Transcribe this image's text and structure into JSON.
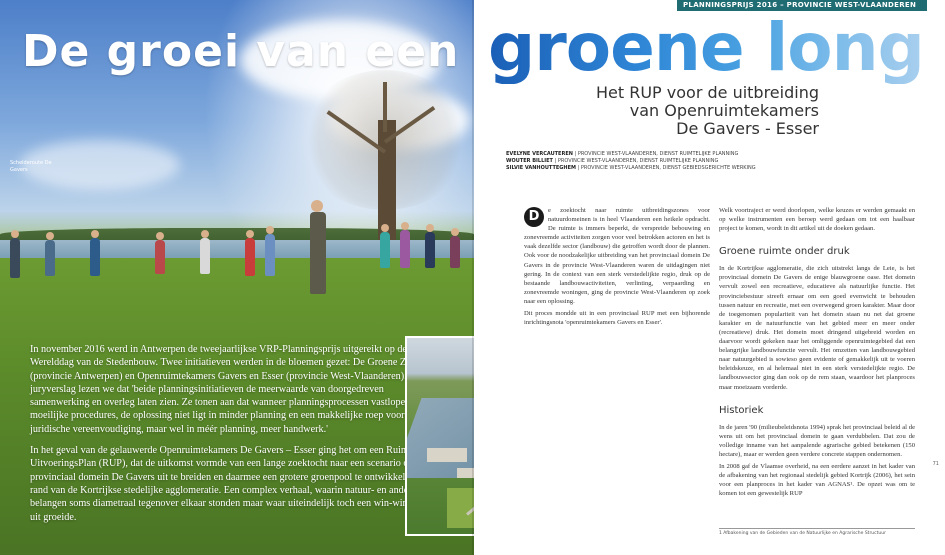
{
  "left_page": {
    "title": "De groei van een",
    "photo_credit": [
      "Schelderoute De",
      "Gavers"
    ],
    "intro_paragraphs": [
      "In november 2016 werd in Antwerpen de tweejaarlijkse VRP-Planningsprijs uitgereikt op de Werelddag van de Stedenbouw. Twee initiatieven werden in de bloemen gezet: De Groene Zes (provincie Antwerpen) en Openruimtekamers Gavers en Esser (provincie West-Vlaanderen). In het juryverslag lezen we dat 'beide planningsinitiatieven de meerwaarde van doorgedreven samenwerking en overleg laten zien. Ze tonen aan dat wanneer planningsprocessen vastlopen in moeilijke procedures, de oplossing niet ligt in minder planning en een makkelijke roep voor juridische vereenvoudiging, maar wel in méér planning, meer handwerk.'",
      "In het geval van de gelauwerde Openruimtekamers De Gavers – Esser ging het om een Ruimtelijk UitvoeringsPlan (RUP), dat de uitkomst vormde van een lange zoektocht naar een scenario om het provinciaal domein De Gavers uit te breiden en daarmee een grotere groenpool te ontwikkelen in de rand van de Kortrijkse stedelijke agglomeratie. Een complex verhaal, waarin natuur- en andere belangen soms diametraal tegenover elkaar stonden maar waar uiteindelijk toch een win-win situatie uit groeide."
    ]
  },
  "right_page": {
    "header_label": "PLANNINGSPRIJS 2016 – PROVINCIE WEST-VLAANDEREN",
    "title": "groene long",
    "subtitle_lines": [
      "Het RUP voor de uitbreiding",
      "van Openruimtekamers",
      "De Gavers - Esser"
    ],
    "authors": [
      {
        "name": "EVELYNE VERCAUTEREN",
        "affiliation": "PROVINCIE WEST-VLAANDEREN, DIENST RUIMTELIJKE PLANNING"
      },
      {
        "name": "WOUTER BILLIET",
        "affiliation": "PROVINCIE WEST-VLAANDEREN, DIENST RUIMTELIJKE PLANNING"
      },
      {
        "name": "SILVIE VANHOUTTEGHEM",
        "affiliation": "PROVINCIE WEST-VLAANDEREN, DIENST GEBIEDSGERICHTE WERKING"
      }
    ],
    "dropcap": "D",
    "col1_paragraphs": [
      "e zoektocht naar ruimte uitbreidingszones voor natuurdomeinen is in heel Vlaanderen een heikele opdracht. De ruimte is immers beperkt, de verspreide bebouwing en zonevreemde activiteiten zorgen voor veel betrokken actoren en het is vaak dezelfde sector (landbouw) die getroffen wordt door de plannen. Ook voor de noodzakelijke uitbreiding van het provinciaal domein De Gavers in de provincie West-Vlaanderen waren de uitdagingen niet gering. In de context van een sterk verstedelijkte regio, druk op de bestaande landbouwactiviteiten, verlinting, verpaarding en zonevreemde woningen, ging de provincie West-Vlaanderen op zoek naar een oplossing.",
      "Dit proces mondde uit in een provinciaal RUP met een bijhorende inrichtingsnota 'openruimtekamers Gavers en Esser'."
    ],
    "col2_intro": "Welk voortraject er werd doorlopen, welke keuzes er werden gemaakt en op welke instrumenten een beroep werd gedaan om tot een haalbaar project te komen, wordt in dit artikel uit de doeken gedaan.",
    "section1_heading": "Groene ruimte onder druk",
    "section1_text": "In de Kortrijkse agglomeratie, die zich uitstrekt langs de Leie, is het provinciaal domein De Gavers de enige blauwgroene oase. Het domein vervult zowel een recreatieve, educatieve als natuurlijke functie. Het provinciebestuur streeft ernaar om een goed evenwicht te behouden tussen natuur en recreatie, met een overwegend groen karakter. Maar door de toegenomen populariteit van het domein staan nu net dat groene karakter en de natuurfunctie van het gebied meer en meer onder (recreatieve) druk. Het domein moet dringend uitgebreid worden en daarvoor wordt gekeken naar het omliggende openruimtegebied dat een belangrijke landbouwfunctie vervult. Het omzetten van landbouwgebied naar natuurgebied is sowieso geen evidente of gemakkelijk uit te voeren beleidskeuze, en al helemaal niet in een sterk verstedelijkte regio. De landbouwsector ging dan ook op de rem staan, waardoor het planproces maar moeizaam vorderde.",
    "section2_heading": "Historiek",
    "section2_paragraphs": [
      "In de jaren '90 (milieubeleidsnota 1994) sprak het provinciaal beleid al de wens uit om het provinciaal domein te gaan verdubbelen. Dat zou de volledige inname van het aanpalende agrarische gebied betekenen (150 hectare), maar er werden geen verdere concrete stappen ondernomen.",
      "In 2008 gaf de Vlaamse overheid, na een eerdere aanzet in het kader van de afbakening van het regionaal stedelijk gebied Kortrijk (2006), het sein voor een planproces in het kader van AGNAS¹. De opzet was om te komen tot een gewestelijk RUP"
    ],
    "footnote": "1   Afbakening van de Gebieden van de Natuurlijke en Agrarische Structuur",
    "page_number": "71"
  }
}
